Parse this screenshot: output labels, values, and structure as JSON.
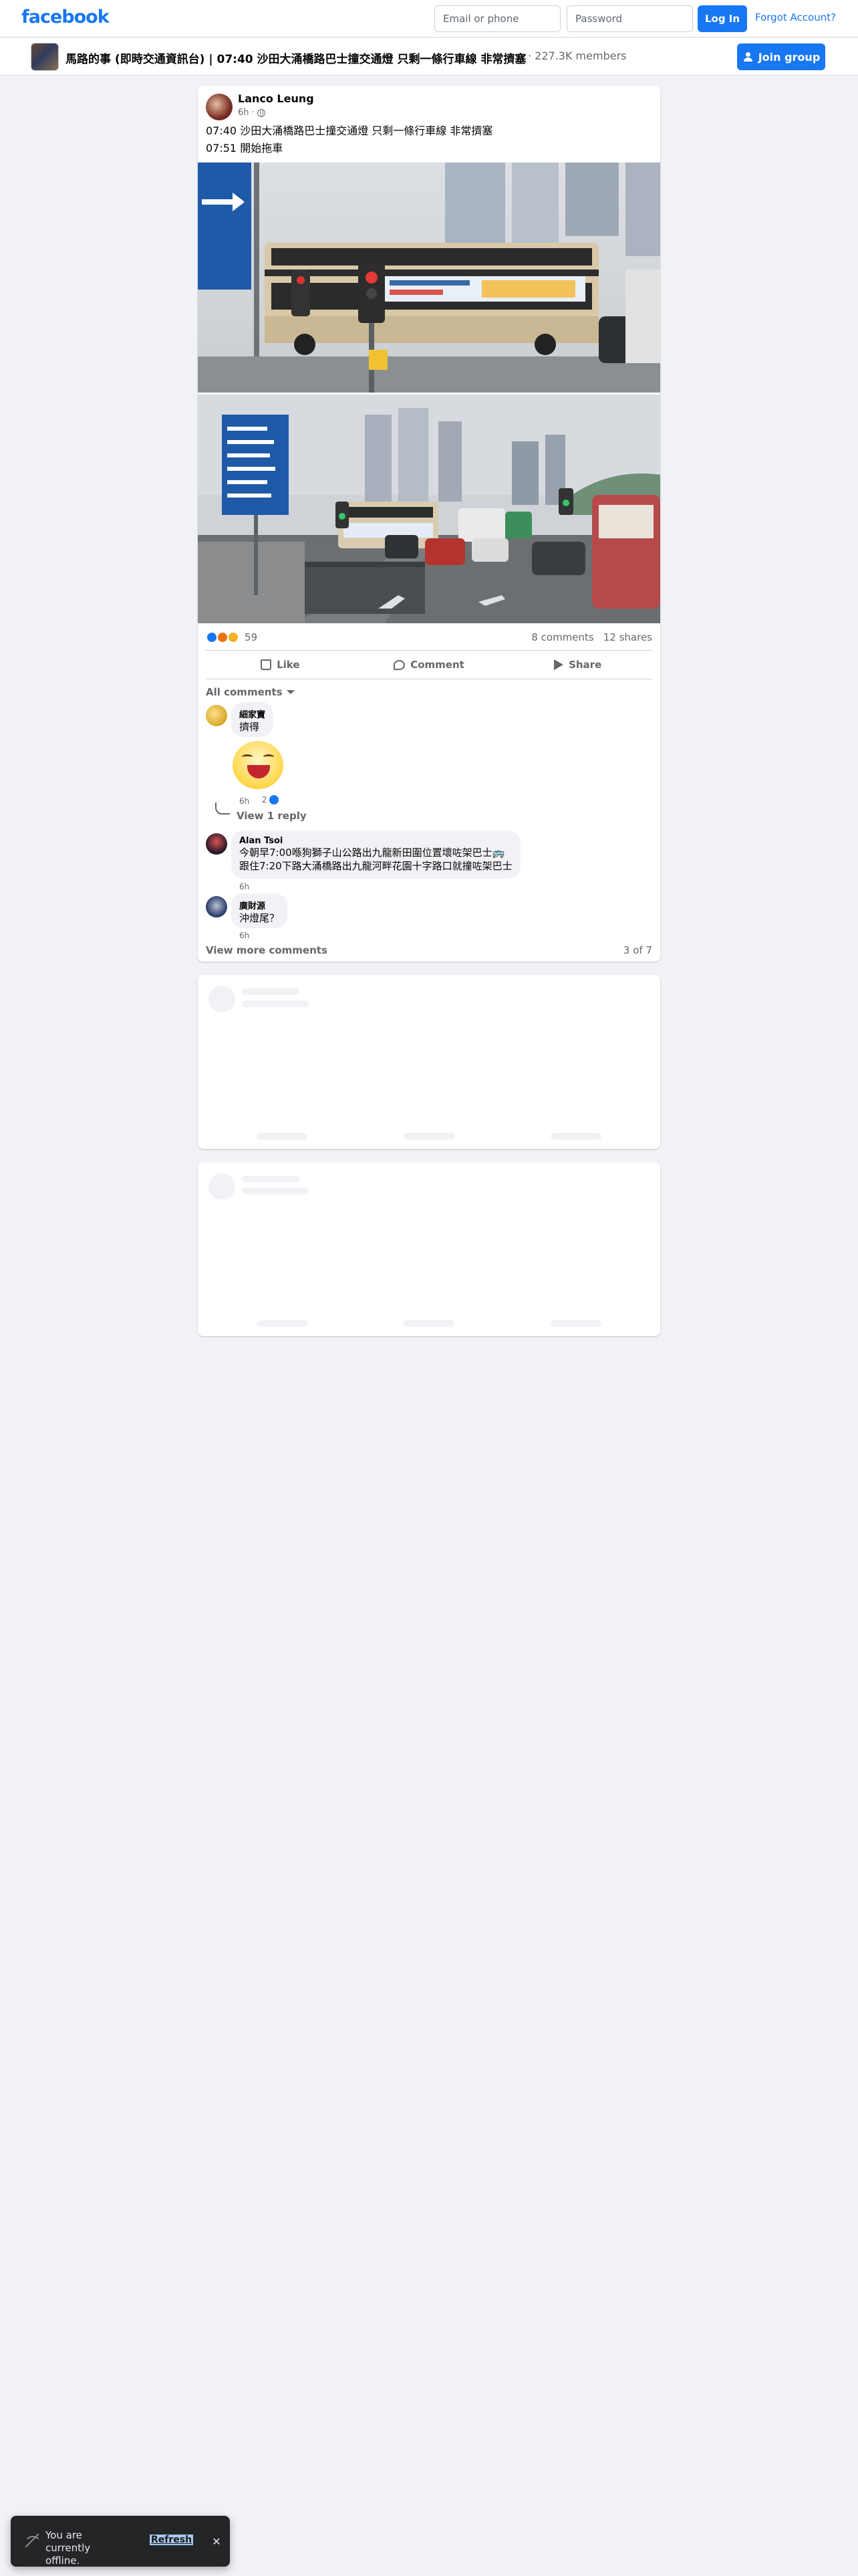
{
  "header": {
    "logo": "facebook",
    "email_placeholder": "Email or phone",
    "password_placeholder": "Password",
    "login_label": "Log In",
    "forgot_label": "Forgot Account?"
  },
  "group": {
    "title": "馬路的事 (即時交通資訊台) | 07:40 沙田大涌橋路巴士撞交通燈 只剩一條行車線 非常擠塞",
    "members": "· 227.3K members",
    "join_label": "Join group"
  },
  "post": {
    "author": "Lanco Leung",
    "time": "6h ·",
    "lines": [
      "07:40 沙田大涌橋路巴士撞交通燈 只剩一條行車線 非常擠塞",
      "07:51 開始拖車"
    ],
    "reaction_count": "59",
    "comments_count": "8 comments",
    "shares_count": "12 shares",
    "actions": {
      "like": "Like",
      "comment": "Comment",
      "share": "Share"
    },
    "all_comments_label": "All comments"
  },
  "comments": [
    {
      "name": "細家寶",
      "text": "擠得",
      "time": "6h",
      "reaction_count": "2",
      "view_reply": "View 1 reply"
    },
    {
      "name": "Alan Tsoi",
      "text_lines": [
        "今朝早7:00喺狗獅子山公路出九龍新田圍位置壞咗架巴士🚌",
        "跟住7:20下路大涌橋路出九龍河畔花園十字路口就撞咗架巴士"
      ],
      "time": "6h"
    },
    {
      "name": "廣財源",
      "text": "沖燈尾？",
      "time": "6h"
    }
  ],
  "footer": {
    "view_more": "View more comments",
    "page_count": "3 of 7"
  },
  "toast": {
    "message": "You are currently offline.",
    "refresh": "Refresh",
    "close": "✕"
  },
  "colors": {
    "brand": "#1877f2",
    "page_bg": "#f0f2f5",
    "muted_text": "#65676b"
  }
}
